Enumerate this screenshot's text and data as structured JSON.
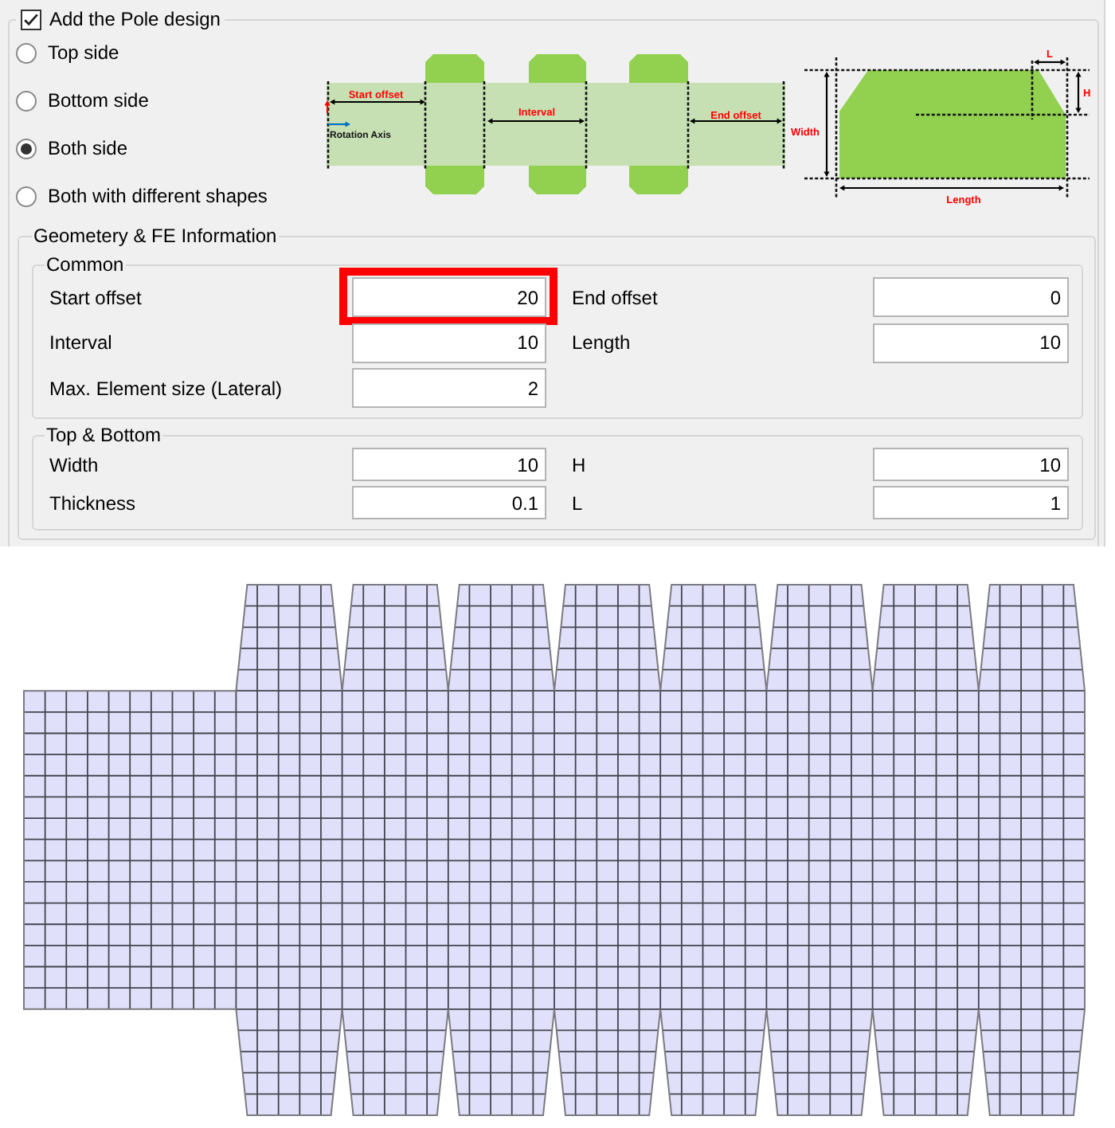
{
  "pole_design": {
    "label": "Add the Pole design",
    "checked": true,
    "sides": [
      {
        "label": "Top side",
        "selected": false
      },
      {
        "label": "Bottom side",
        "selected": false
      },
      {
        "label": "Both side",
        "selected": true
      },
      {
        "label": "Both with different shapes",
        "selected": false
      }
    ],
    "layout_diagram": {
      "start_offset": "Start offset",
      "interval": "Interval",
      "end_offset": "End offset",
      "axis": "Rotation Axis"
    },
    "profile_diagram": {
      "width": "Width",
      "length": "Length",
      "l": "L",
      "h": "H"
    }
  },
  "geometry": {
    "title": "Geometery & FE Information",
    "groups": [
      {
        "title": "Common",
        "fields": [
          {
            "label": "Start offset",
            "value": "20",
            "highlighted": true
          },
          {
            "label": "End offset",
            "value": "0",
            "highlighted": false
          },
          {
            "label": "Interval",
            "value": "10",
            "highlighted": false
          },
          {
            "label": "Length",
            "value": "10",
            "highlighted": false
          },
          {
            "label": "Max. Element size (Lateral)",
            "value": "2",
            "highlighted": false
          }
        ]
      },
      {
        "title": "Top & Bottom",
        "fields": [
          {
            "label": "Width",
            "value": "10",
            "highlighted": false
          },
          {
            "label": "H",
            "value": "10",
            "highlighted": false
          },
          {
            "label": "Thickness",
            "value": "0.1",
            "highlighted": false
          },
          {
            "label": "L",
            "value": "1",
            "highlighted": false
          }
        ]
      }
    ]
  }
}
